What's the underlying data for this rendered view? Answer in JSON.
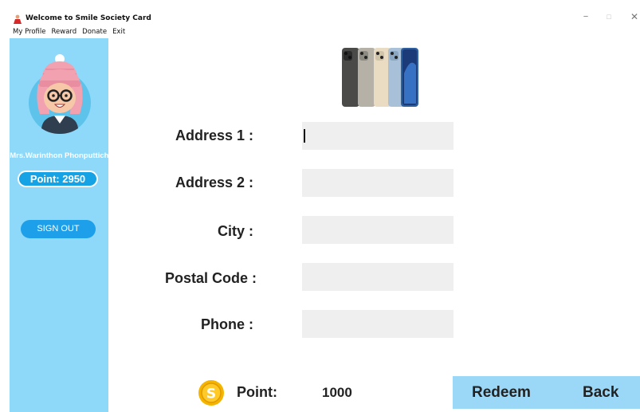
{
  "window": {
    "title": "Welcome to Smile Society Card",
    "minimize": "−",
    "maximize": "□",
    "close": "✕"
  },
  "menu": [
    "My Profile",
    "Reward",
    "Donate",
    "Exit"
  ],
  "sidebar": {
    "user_name": "Mrs.Warinthon Phonputticha",
    "points_label": "Point: 2950",
    "signout_label": "SIGN OUT"
  },
  "form": {
    "fields": [
      {
        "label": "Address 1 :",
        "value": ""
      },
      {
        "label": "Address 2 :",
        "value": ""
      },
      {
        "label": "City :",
        "value": ""
      },
      {
        "label": "Postal Code :",
        "value": ""
      },
      {
        "label": "Phone :",
        "value": ""
      }
    ]
  },
  "bottom": {
    "coin_letter": "S",
    "point_label": "Point:",
    "point_value": "1000",
    "redeem_label": "Redeem",
    "back_label": "Back"
  },
  "colors": {
    "sidebar_bg": "#8ed9f9",
    "accent": "#15a3e6",
    "action_bar": "#9bd8f8",
    "input_bg": "#efefef"
  },
  "icons": [
    "app-icon",
    "avatar-icon",
    "product-image",
    "coin-icon"
  ]
}
